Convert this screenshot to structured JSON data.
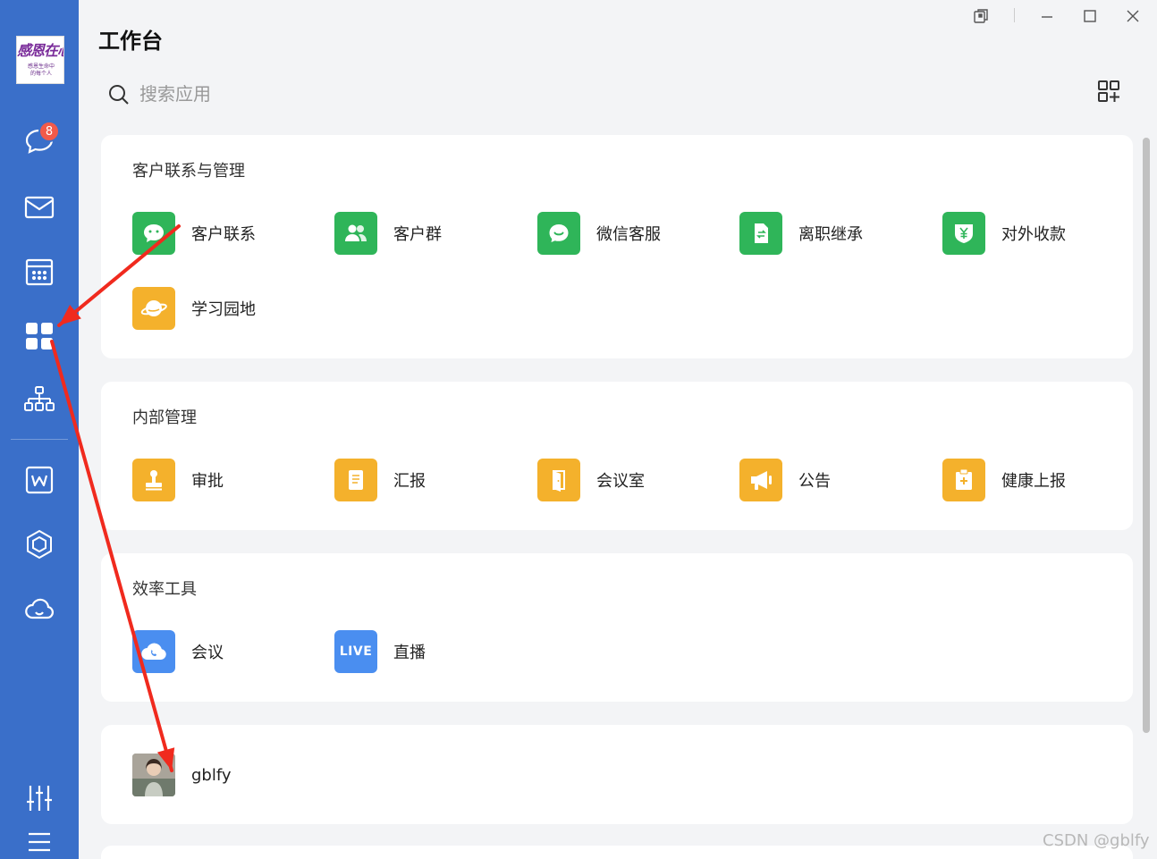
{
  "sidebar": {
    "logo_text": "感恩在心",
    "logo_subtext": "感恩生命中的每个人",
    "unread_badge": "8",
    "items": [
      {
        "name": "messages",
        "icon": "chat-bubble-icon"
      },
      {
        "name": "mail",
        "icon": "mail-icon"
      },
      {
        "name": "calendar",
        "icon": "calendar-icon"
      },
      {
        "name": "workbench",
        "icon": "apps-grid-icon",
        "active": true
      },
      {
        "name": "contacts",
        "icon": "org-chart-icon"
      },
      {
        "name": "docs",
        "icon": "w-doc-icon"
      },
      {
        "name": "workspace",
        "icon": "cube-icon"
      },
      {
        "name": "cloud",
        "icon": "cloud-icon"
      },
      {
        "name": "settings",
        "icon": "sliders-icon"
      },
      {
        "name": "menu",
        "icon": "hamburger-icon"
      }
    ]
  },
  "header": {
    "title": "工作台"
  },
  "search": {
    "placeholder": "搜索应用"
  },
  "sections": [
    {
      "title": "客户联系与管理",
      "apps": [
        {
          "label": "客户联系",
          "icon": "wechat-icon",
          "color": "#2fb559"
        },
        {
          "label": "客户群",
          "icon": "group-icon",
          "color": "#2fb559"
        },
        {
          "label": "微信客服",
          "icon": "service-chat-icon",
          "color": "#2fb559"
        },
        {
          "label": "离职继承",
          "icon": "transfer-doc-icon",
          "color": "#2fb559"
        },
        {
          "label": "对外收款",
          "icon": "yen-shield-icon",
          "color": "#2fb559"
        },
        {
          "label": "学习园地",
          "icon": "planet-icon",
          "color": "#f4b12c"
        }
      ]
    },
    {
      "title": "内部管理",
      "apps": [
        {
          "label": "审批",
          "icon": "stamp-icon",
          "color": "#f4b12c"
        },
        {
          "label": "汇报",
          "icon": "report-icon",
          "color": "#f4b12c"
        },
        {
          "label": "会议室",
          "icon": "door-icon",
          "color": "#f4b12c"
        },
        {
          "label": "公告",
          "icon": "megaphone-icon",
          "color": "#f4b12c"
        },
        {
          "label": "健康上报",
          "icon": "health-clipboard-icon",
          "color": "#f4b12c"
        }
      ]
    },
    {
      "title": "效率工具",
      "apps": [
        {
          "label": "会议",
          "icon": "cloud-phone-icon",
          "color": "#4a8ef0"
        },
        {
          "label": "直播",
          "icon": "live-icon",
          "color": "#4a8ef0",
          "icon_text": "LIVE"
        }
      ]
    },
    {
      "title": "",
      "apps": [
        {
          "label": "gblfy",
          "icon": "user-avatar"
        }
      ]
    }
  ],
  "watermark": "CSDN @gblfy",
  "annotation_color": "#f02a1e"
}
